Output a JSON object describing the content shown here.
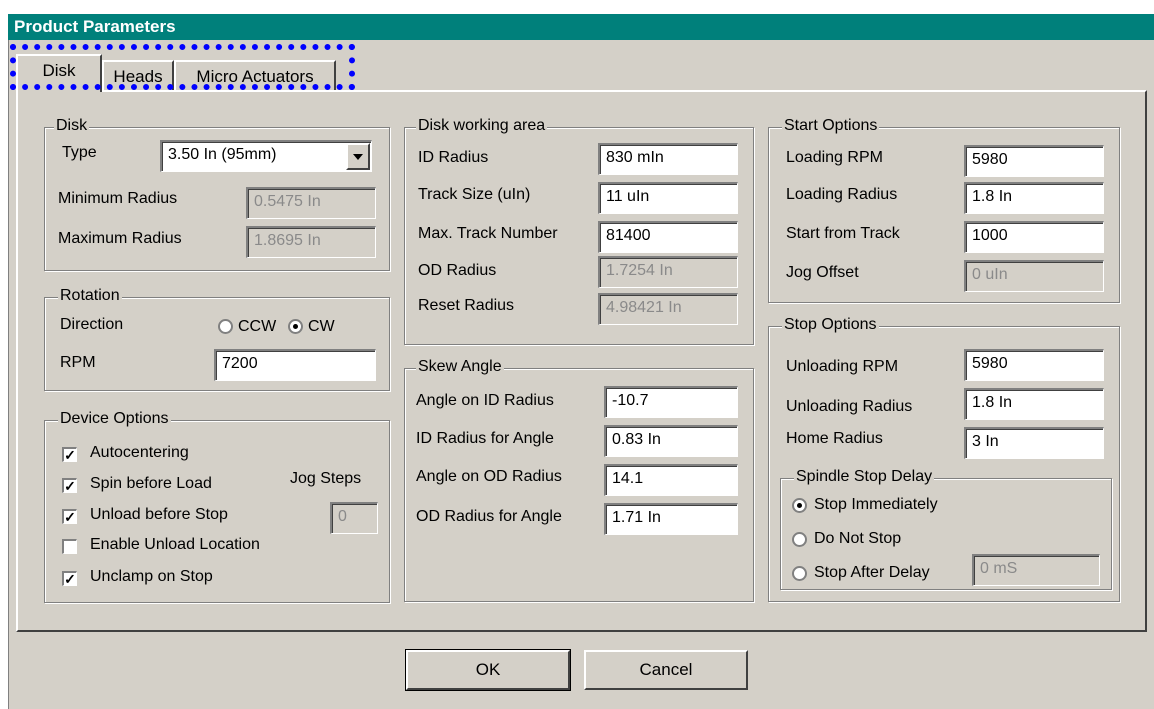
{
  "window": {
    "title": "Product Parameters"
  },
  "tabs": [
    {
      "label": "Disk",
      "active": true
    },
    {
      "label": "Heads",
      "active": false
    },
    {
      "label": "Micro Actuators",
      "active": false
    }
  ],
  "disk": {
    "legend": "Disk",
    "type_label": "Type",
    "type_value": "3.50 In (95mm)",
    "min_radius_label": "Minimum Radius",
    "min_radius_value": "0.5475 In",
    "max_radius_label": "Maximum Radius",
    "max_radius_value": "1.8695 In"
  },
  "rotation": {
    "legend": "Rotation",
    "direction_label": "Direction",
    "ccw_label": "CCW",
    "cw_label": "CW",
    "selected": "CW",
    "rpm_label": "RPM",
    "rpm_value": "7200"
  },
  "device_options": {
    "legend": "Device Options",
    "autocentering": {
      "label": "Autocentering",
      "checked": true
    },
    "spin_before_load": {
      "label": "Spin before Load",
      "checked": true
    },
    "unload_before_stop": {
      "label": "Unload before Stop",
      "checked": true
    },
    "enable_unload_location": {
      "label": "Enable Unload Location",
      "checked": false
    },
    "unclamp_on_stop": {
      "label": "Unclamp on Stop",
      "checked": true
    },
    "jog_steps_label": "Jog Steps",
    "jog_steps_value": "0"
  },
  "working_area": {
    "legend": "Disk working area",
    "id_radius_label": "ID Radius",
    "id_radius_value": "830 mIn",
    "track_size_label": "Track Size (uIn)",
    "track_size_value": "11 uIn",
    "max_track_label": "Max. Track Number",
    "max_track_value": "81400",
    "od_radius_label": "OD Radius",
    "od_radius_value": "1.7254 In",
    "reset_radius_label": "Reset Radius",
    "reset_radius_value": "4.98421 In"
  },
  "skew": {
    "legend": "Skew Angle",
    "angle_id_label": "Angle on ID Radius",
    "angle_id_value": "-10.7",
    "id_for_angle_label": "ID Radius for Angle",
    "id_for_angle_value": "0.83 In",
    "angle_od_label": "Angle on OD Radius",
    "angle_od_value": "14.1",
    "od_for_angle_label": "OD Radius for Angle",
    "od_for_angle_value": "1.71 In"
  },
  "start": {
    "legend": "Start Options",
    "loading_rpm_label": "Loading RPM",
    "loading_rpm_value": "5980",
    "loading_radius_label": "Loading Radius",
    "loading_radius_value": "1.8 In",
    "start_track_label": "Start from Track",
    "start_track_value": "1000",
    "jog_offset_label": "Jog Offset",
    "jog_offset_value": "0 uIn"
  },
  "stop": {
    "legend": "Stop Options",
    "unloading_rpm_label": "Unloading RPM",
    "unloading_rpm_value": "5980",
    "unloading_radius_label": "Unloading Radius",
    "unloading_radius_value": "1.8 In",
    "home_radius_label": "Home Radius",
    "home_radius_value": "3 In"
  },
  "spindle": {
    "legend": "Spindle Stop Delay",
    "immediately_label": "Stop Immediately",
    "not_stop_label": "Do Not Stop",
    "after_delay_label": "Stop After Delay",
    "delay_value": "0 mS",
    "selected": "Stop Immediately"
  },
  "buttons": {
    "ok": "OK",
    "cancel": "Cancel"
  }
}
